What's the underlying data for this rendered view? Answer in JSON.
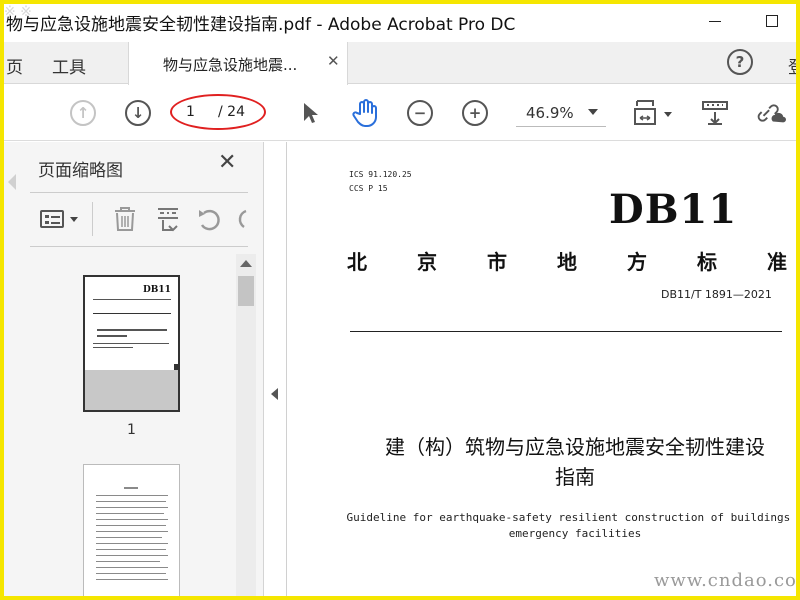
{
  "window": {
    "title": "物与应急设施地震安全韧性建设指南.pdf - Adobe Acrobat Pro DC"
  },
  "tabs": {
    "home": "页",
    "tools": "工具",
    "document": "物与应急设施地震...",
    "right_cut": "登"
  },
  "toolbar": {
    "current_page": "1",
    "total_pages": "/ 24",
    "zoom": "46.9%"
  },
  "panel": {
    "title": "页面缩略图",
    "thumb_label": "1"
  },
  "document": {
    "ics": "ICS  91.120.25",
    "ccs": "CCS  P 15",
    "db": "DB11",
    "std_chars": [
      "北",
      "京",
      "市",
      "地",
      "方",
      "标",
      "准"
    ],
    "std_code": "DB11/T 1891—2021",
    "cn_title_1": "建（构）筑物与应急设施地震安全韧性建设",
    "cn_title_2": "指南",
    "en_title_1": "Guideline for earthquake-safety resilient construction of buildings &",
    "en_title_2": "emergency facilities"
  },
  "overlay": {
    "watermark": "www.cndao.com",
    "corner": "※  ※"
  },
  "colors": {
    "accent_blue": "#2a6fdb",
    "annotation_red": "#e02020",
    "frame_yellow": "#f5e600"
  }
}
